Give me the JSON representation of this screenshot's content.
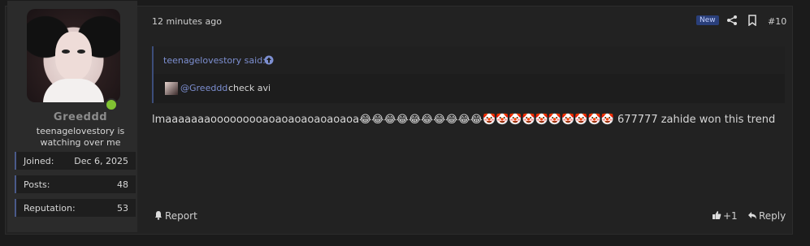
{
  "user": {
    "username": "Greeddd",
    "title": "teenagelovestory is watching over me",
    "online": true,
    "stats": [
      {
        "label": "Joined:",
        "value": "Dec 6, 2025"
      },
      {
        "label": "Posts:",
        "value": "48"
      },
      {
        "label": "Reputation:",
        "value": "53"
      }
    ]
  },
  "post": {
    "time": "12 minutes ago",
    "badge": "New",
    "number": "#10",
    "quote": {
      "author": "teenagelovestory said:",
      "mention": "@Greeddd",
      "text": "check avi"
    },
    "text_prefix": "lmaaaaaaaooooooooaoaoaoaoaoaoaoa",
    "emoji_run": "😂😂😂😂😂😂😂😂😂😂🤡🤡🤡🤡🤡🤡🤡🤡🤡🤡",
    "text_suffix": " 677777 zahide won this trend",
    "actions": {
      "report": "Report",
      "like": "+1",
      "reply": "Reply"
    }
  },
  "colors": {
    "accent": "#7d8fd1",
    "online": "#80c232",
    "new_badge": "#2a3f7a"
  },
  "icons": [
    "share-icon",
    "bookmark-icon",
    "arrow-up-icon",
    "bell-icon",
    "thumbs-up-icon",
    "reply-icon"
  ]
}
